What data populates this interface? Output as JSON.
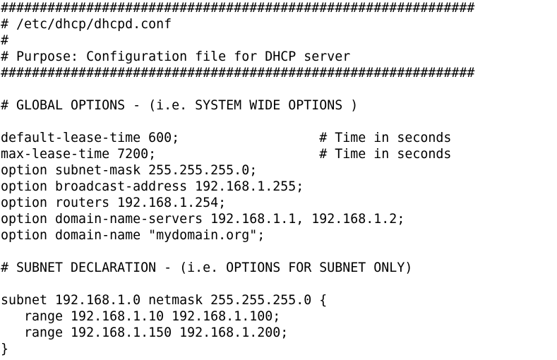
{
  "file": {
    "lines": [
      "#############################################################",
      "# /etc/dhcp/dhcpd.conf",
      "#",
      "# Purpose: Configuration file for DHCP server",
      "#############################################################",
      "",
      "# GLOBAL OPTIONS - (i.e. SYSTEM WIDE OPTIONS )",
      "",
      "default-lease-time 600;                  # Time in seconds",
      "max-lease-time 7200;                     # Time in seconds",
      "option subnet-mask 255.255.255.0;",
      "option broadcast-address 192.168.1.255;",
      "option routers 192.168.1.254;",
      "option domain-name-servers 192.168.1.1, 192.168.1.2;",
      "option domain-name \"mydomain.org\";",
      "",
      "# SUBNET DECLARATION - (i.e. OPTIONS FOR SUBNET ONLY)",
      "",
      "subnet 192.168.1.0 netmask 255.255.255.0 {",
      "   range 192.168.1.10 192.168.1.100;",
      "   range 192.168.1.150 192.168.1.200;",
      "}"
    ]
  },
  "colors": {
    "background": "#ffffff",
    "text": "#000000"
  }
}
